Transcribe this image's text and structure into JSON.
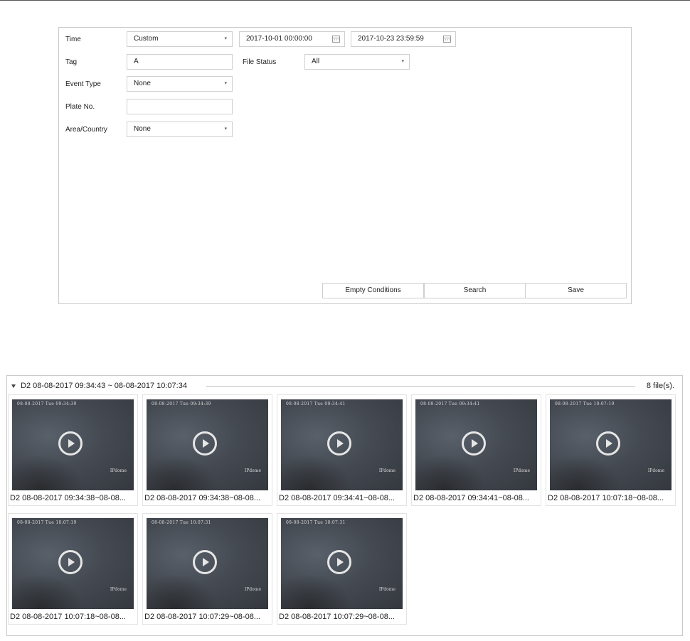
{
  "search_form": {
    "time_label": "Time",
    "time_mode": "Custom",
    "start_time": "2017-10-01 00:00:00",
    "end_time": "2017-10-23 23:59:59",
    "tag_label": "Tag",
    "tag_value": "A",
    "file_status_label": "File Status",
    "file_status_value": "All",
    "event_type_label": "Event Type",
    "event_type_value": "None",
    "plate_label": "Plate No.",
    "plate_value": "",
    "area_label": "Area/Country",
    "area_value": "None",
    "buttons": {
      "empty_conditions": "Empty Conditions",
      "search": "Search",
      "save": "Save"
    }
  },
  "results": {
    "group_title": "D2 08-08-2017 09:34:43 ~ 08-08-2017 10:07:34",
    "file_count": "8 file(s).",
    "items": [
      {
        "osd_time": "08-08-2017 Tue 09:34:39",
        "osd_name": "IPdome",
        "caption": "D2 08-08-2017 09:34:38~08-08..."
      },
      {
        "osd_time": "08-08-2017 Tue 09:34:39",
        "osd_name": "IPdome",
        "caption": "D2 08-08-2017 09:34:38~08-08..."
      },
      {
        "osd_time": "08-08-2017 Tue 09:34:41",
        "osd_name": "IPdome",
        "caption": "D2 08-08-2017 09:34:41~08-08..."
      },
      {
        "osd_time": "08-08-2017 Tue 09:34:41",
        "osd_name": "IPdome",
        "caption": "D2 08-08-2017 09:34:41~08-08..."
      },
      {
        "osd_time": "08-08-2017 Tue 10:07:19",
        "osd_name": "IPdome",
        "caption": "D2 08-08-2017 10:07:18~08-08..."
      },
      {
        "osd_time": "08-08-2017 Tue 10:07:19",
        "osd_name": "IPdome",
        "caption": "D2 08-08-2017 10:07:18~08-08..."
      },
      {
        "osd_time": "08-08-2017 Tue 10:07:31",
        "osd_name": "IPdome",
        "caption": "D2 08-08-2017 10:07:29~08-08..."
      },
      {
        "osd_time": "08-08-2017 Tue 10:07:31",
        "osd_name": "IPdome",
        "caption": "D2 08-08-2017 10:07:29~08-08..."
      }
    ]
  }
}
